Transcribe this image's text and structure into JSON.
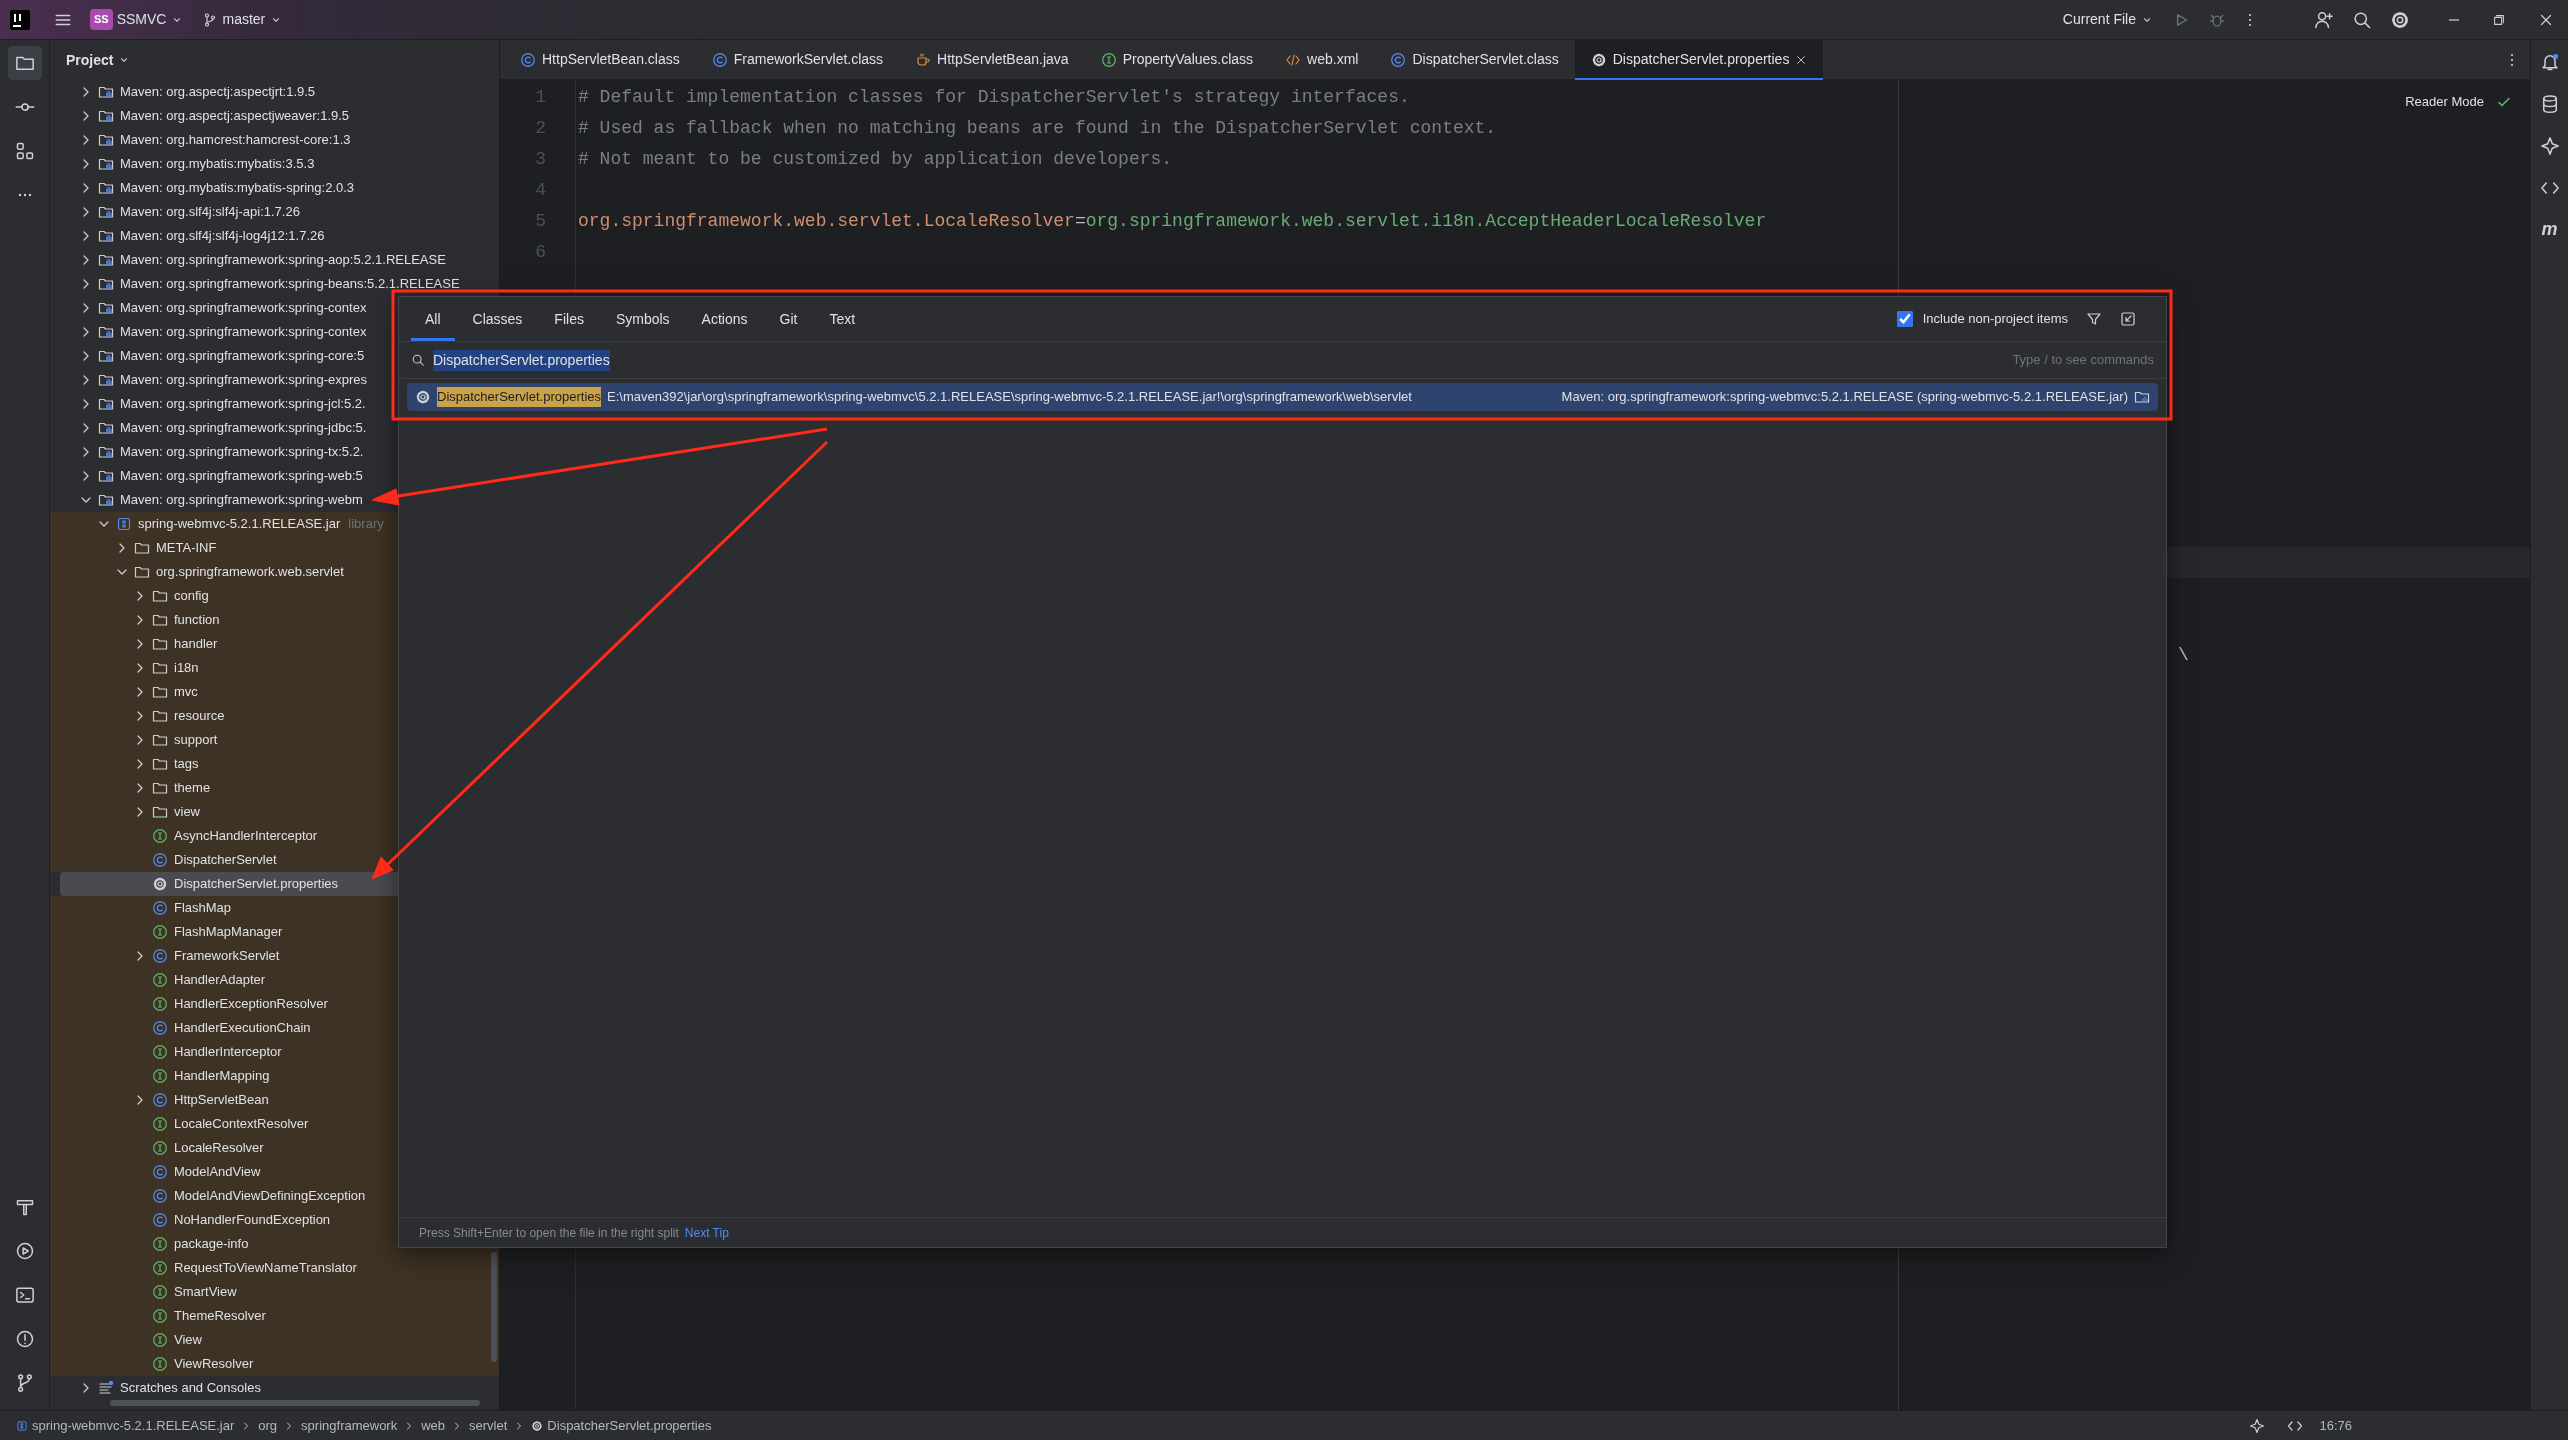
{
  "title_bar": {
    "project_badge": "SS",
    "project": "SSMVC",
    "branch": "master",
    "run_config": "Current File"
  },
  "left_toolbar": [
    {
      "selected": true
    },
    {
      "selected": false
    },
    {
      "selected": false
    },
    {
      "selected": false
    },
    {
      "selected": false
    },
    {
      "selected": false
    },
    {
      "selected": false
    },
    {
      "selected": false
    },
    {
      "selected": false
    }
  ],
  "project_panel": {
    "title": "Project",
    "tree": [
      {
        "label": "Maven: org.aspectj:aspectjrt:1.9.5",
        "kind": "maven",
        "expanded": false,
        "selected": false
      },
      {
        "label": "Maven: org.aspectj:aspectjweaver:1.9.5",
        "kind": "maven",
        "expanded": false,
        "selected": false
      },
      {
        "label": "Maven: org.hamcrest:hamcrest-core:1.3",
        "kind": "maven",
        "expanded": false,
        "selected": false
      },
      {
        "label": "Maven: org.mybatis:mybatis:3.5.3",
        "kind": "maven",
        "expanded": false,
        "selected": false
      },
      {
        "label": "Maven: org.mybatis:mybatis-spring:2.0.3",
        "kind": "maven",
        "expanded": false,
        "selected": false
      },
      {
        "label": "Maven: org.slf4j:slf4j-api:1.7.26",
        "kind": "maven",
        "expanded": false,
        "selected": false
      },
      {
        "label": "Maven: org.slf4j:slf4j-log4j12:1.7.26",
        "kind": "maven",
        "expanded": false,
        "selected": false
      },
      {
        "label": "Maven: org.springframework:spring-aop:5.2.1.RELEASE",
        "kind": "maven",
        "expanded": false,
        "selected": false
      },
      {
        "label": "Maven: org.springframework:spring-beans:5.2.1.RELEASE",
        "kind": "maven",
        "expanded": false,
        "selected": false
      },
      {
        "label": "Maven: org.springframework:spring-contex",
        "kind": "maven",
        "expanded": false,
        "selected": false
      },
      {
        "label": "Maven: org.springframework:spring-contex",
        "kind": "maven",
        "expanded": false,
        "selected": false
      },
      {
        "label": "Maven: org.springframework:spring-core:5",
        "kind": "maven",
        "expanded": false,
        "selected": false
      },
      {
        "label": "Maven: org.springframework:spring-expres",
        "kind": "maven",
        "expanded": false,
        "selected": false
      },
      {
        "label": "Maven: org.springframework:spring-jcl:5.2.",
        "kind": "maven",
        "expanded": false,
        "selected": false
      },
      {
        "label": "Maven: org.springframework:spring-jdbc:5.",
        "kind": "maven",
        "expanded": false,
        "selected": false
      },
      {
        "label": "Maven: org.springframework:spring-tx:5.2.",
        "kind": "maven",
        "expanded": false,
        "selected": false
      },
      {
        "label": "Maven: org.springframework:spring-web:5",
        "kind": "maven",
        "expanded": false,
        "selected": false
      },
      {
        "label": "Maven: org.springframework:spring-webm",
        "kind": "maven",
        "expanded": true,
        "selected": false,
        "children": [
          {
            "label": "spring-webmvc-5.2.1.RELEASE.jar",
            "suffix": "library",
            "kind": "jar",
            "expanded": true,
            "selected": false,
            "scope_highlight": true,
            "children": [
              {
                "label": "META-INF",
                "kind": "folder",
                "expanded": false,
                "selected": false
              },
              {
                "label": "org.springframework.web.servlet",
                "kind": "folder",
                "expanded": true,
                "selected": false,
                "children": [
                  {
                    "label": "config",
                    "kind": "folder",
                    "expanded": false,
                    "selected": false
                  },
                  {
                    "label": "function",
                    "kind": "folder",
                    "expanded": false,
                    "selected": false
                  },
                  {
                    "label": "handler",
                    "kind": "folder",
                    "expanded": false,
                    "selected": false
                  },
                  {
                    "label": "i18n",
                    "kind": "folder",
                    "expanded": false,
                    "selected": false
                  },
                  {
                    "label": "mvc",
                    "kind": "folder",
                    "expanded": false,
                    "selected": false
                  },
                  {
                    "label": "resource",
                    "kind": "folder",
                    "expanded": false,
                    "selected": false
                  },
                  {
                    "label": "support",
                    "kind": "folder",
                    "expanded": false,
                    "selected": false
                  },
                  {
                    "label": "tags",
                    "kind": "folder",
                    "expanded": false,
                    "selected": false
                  },
                  {
                    "label": "theme",
                    "kind": "folder",
                    "expanded": false,
                    "selected": false
                  },
                  {
                    "label": "view",
                    "kind": "folder",
                    "expanded": false,
                    "selected": false
                  },
                  {
                    "label": "AsyncHandlerInterceptor",
                    "kind": "interface",
                    "selected": false
                  },
                  {
                    "label": "DispatcherServlet",
                    "kind": "class",
                    "selected": false
                  },
                  {
                    "label": "DispatcherServlet.properties",
                    "kind": "properties",
                    "selected": true
                  },
                  {
                    "label": "FlashMap",
                    "kind": "class",
                    "selected": false
                  },
                  {
                    "label": "FlashMapManager",
                    "kind": "interface",
                    "selected": false
                  },
                  {
                    "label": "FrameworkServlet",
                    "kind": "class",
                    "expanded": false,
                    "selected": false
                  },
                  {
                    "label": "HandlerAdapter",
                    "kind": "interface",
                    "selected": false
                  },
                  {
                    "label": "HandlerExceptionResolver",
                    "kind": "interface",
                    "selected": false
                  },
                  {
                    "label": "HandlerExecutionChain",
                    "kind": "class",
                    "selected": false
                  },
                  {
                    "label": "HandlerInterceptor",
                    "kind": "interface",
                    "selected": false
                  },
                  {
                    "label": "HandlerMapping",
                    "kind": "interface",
                    "selected": false
                  },
                  {
                    "label": "HttpServletBean",
                    "kind": "class",
                    "expanded": false,
                    "selected": false
                  },
                  {
                    "label": "LocaleContextResolver",
                    "kind": "interface",
                    "selected": false
                  },
                  {
                    "label": "LocaleResolver",
                    "kind": "interface",
                    "selected": false
                  },
                  {
                    "label": "ModelAndView",
                    "kind": "class",
                    "selected": false
                  },
                  {
                    "label": "ModelAndViewDefiningException",
                    "kind": "class",
                    "selected": false
                  },
                  {
                    "label": "NoHandlerFoundException",
                    "kind": "class",
                    "selected": false
                  },
                  {
                    "label": "package-info",
                    "kind": "interface",
                    "selected": false
                  },
                  {
                    "label": "RequestToViewNameTranslator",
                    "kind": "interface",
                    "selected": false
                  },
                  {
                    "label": "SmartView",
                    "kind": "interface",
                    "selected": false
                  },
                  {
                    "label": "ThemeResolver",
                    "kind": "interface",
                    "selected": false
                  },
                  {
                    "label": "View",
                    "kind": "interface",
                    "selected": false
                  },
                  {
                    "label": "ViewResolver",
                    "kind": "interface",
                    "selected": false
                  }
                ]
              }
            ]
          }
        ]
      },
      {
        "label": "Scratches and Consoles",
        "kind": "scratches",
        "expanded": false,
        "selected": false
      }
    ]
  },
  "editor_tabs": [
    {
      "label": "HttpServletBean.class",
      "kind": "class",
      "selected": false
    },
    {
      "label": "FrameworkServlet.class",
      "kind": "class",
      "selected": false
    },
    {
      "label": "HttpServletBean.java",
      "kind": "java",
      "selected": false
    },
    {
      "label": "PropertyValues.class",
      "kind": "interface",
      "selected": false
    },
    {
      "label": "web.xml",
      "kind": "xml",
      "selected": false
    },
    {
      "label": "DispatcherServlet.class",
      "kind": "class",
      "selected": false
    },
    {
      "label": "DispatcherServlet.properties",
      "kind": "properties",
      "selected": true
    }
  ],
  "editor": {
    "reader_mode": "Reader Mode",
    "lines": [
      {
        "number": "1",
        "kind": "comment",
        "text": "# Default implementation classes for DispatcherServlet's strategy interfaces."
      },
      {
        "number": "2",
        "kind": "comment",
        "text": "# Used as fallback when no matching beans are found in the DispatcherServlet context."
      },
      {
        "number": "3",
        "kind": "comment",
        "text": "# Not meant to be customized by application developers."
      },
      {
        "number": "4",
        "kind": "blank"
      },
      {
        "number": "5",
        "kind": "property",
        "key": "org.springframework.web.servlet.LocaleResolver",
        "separator": "=",
        "value": "org.springframework.web.servlet.i18n.AcceptHeaderLocaleResolver"
      },
      {
        "number": "6",
        "kind": "blank"
      }
    ],
    "fragment": "\\"
  },
  "search_popup": {
    "tabs": [
      {
        "label": "All",
        "selected": true
      },
      {
        "label": "Classes",
        "selected": false
      },
      {
        "label": "Files",
        "selected": false
      },
      {
        "label": "Symbols",
        "selected": false
      },
      {
        "label": "Actions",
        "selected": false
      },
      {
        "label": "Git",
        "selected": false
      },
      {
        "label": "Text",
        "selected": false
      }
    ],
    "include_option": {
      "label": "Include non-project items",
      "checked": true
    },
    "query": "DispatcherServlet.properties",
    "hint": "Type / to see commands",
    "results": [
      {
        "name": "DispatcherServlet.properties",
        "path": "E:\\maven392\\jar\\org\\springframework\\spring-webmvc\\5.2.1.RELEASE\\spring-webmvc-5.2.1.RELEASE.jar!\\org\\springframework\\web\\servlet",
        "location": "Maven: org.springframework:spring-webmvc:5.2.1.RELEASE (spring-webmvc-5.2.1.RELEASE.jar)",
        "match_highlight": true,
        "selected": true
      }
    ],
    "footer": {
      "tip": "Press Shift+Enter to open the file in the right split",
      "link": "Next Tip"
    }
  },
  "right_toolbar": {
    "glyph": "m"
  },
  "status_bar": {
    "breadcrumbs": [
      {
        "label": "spring-webmvc-5.2.1.RELEASE.jar",
        "kind": "jar"
      },
      {
        "label": "org",
        "kind": "package"
      },
      {
        "label": "springframework",
        "kind": "package"
      },
      {
        "label": "web",
        "kind": "package"
      },
      {
        "label": "servlet",
        "kind": "package"
      },
      {
        "label": "DispatcherServlet.properties",
        "kind": "properties"
      }
    ],
    "position": "16:76"
  }
}
